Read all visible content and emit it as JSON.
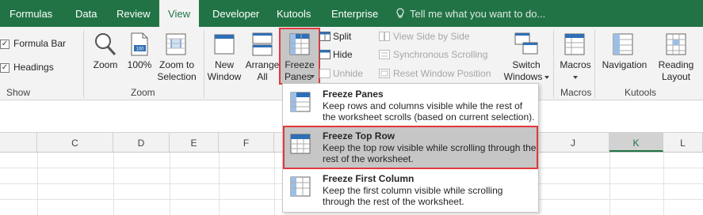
{
  "tabs": [
    "Formulas",
    "Data",
    "Review",
    "View",
    "Developer",
    "Kutools",
    "Enterprise"
  ],
  "active_tab": "View",
  "tell_me": "Tell me what you want to do...",
  "show_group": {
    "formula_bar": "Formula Bar",
    "headings": "Headings",
    "label": "Show"
  },
  "zoom_group": {
    "zoom": "Zoom",
    "hundred": "100%",
    "zoom_to_1": "Zoom to",
    "zoom_to_2": "Selection",
    "label": "Zoom"
  },
  "window_group": {
    "new_1": "New",
    "new_2": "Window",
    "arrange_1": "Arrange",
    "arrange_2": "All",
    "freeze_1": "Freeze",
    "freeze_2": "Panes",
    "split": "Split",
    "hide": "Hide",
    "unhide": "Unhide",
    "side_by_side": "View Side by Side",
    "sync_scroll": "Synchronous Scrolling",
    "reset_pos": "Reset Window Position",
    "switch_1": "Switch",
    "switch_2": "Windows"
  },
  "macros_group": {
    "macros": "Macros",
    "label": "Macros"
  },
  "kutools_group": {
    "navigation": "Navigation",
    "reading_1": "Reading",
    "reading_2": "Layout",
    "label": "Kutools"
  },
  "columns": [
    "C",
    "D",
    "E",
    "F",
    "J",
    "K",
    "L"
  ],
  "selected_column": "K",
  "menu": [
    {
      "title": "Freeze Panes",
      "desc": "Keep rows and columns visible while the rest of the worksheet scrolls (based on current selection)."
    },
    {
      "title": "Freeze Top Row",
      "desc": "Keep the top row visible while scrolling through the rest of the worksheet."
    },
    {
      "title": "Freeze First Column",
      "desc": "Keep the first column visible while scrolling through the rest of the worksheet."
    }
  ],
  "colors": {
    "excel_green": "#217346",
    "highlight": "#c6c6c6",
    "red_outline": "#e0383e"
  }
}
